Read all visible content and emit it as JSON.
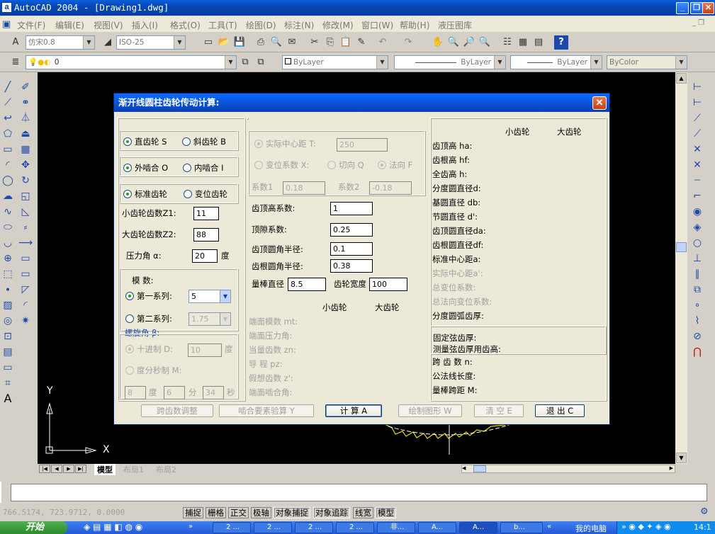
{
  "app": {
    "title": "AutoCAD 2004 - [Drawing1.dwg]"
  },
  "menu": [
    "文件(F)",
    "编辑(E)",
    "视图(V)",
    "插入(I)",
    "格式(O)",
    "工具(T)",
    "绘图(D)",
    "标注(N)",
    "修改(M)",
    "窗口(W)",
    "帮助(H)",
    "液压图库"
  ],
  "toolbar": {
    "text_style": "仿宋0.8",
    "dim_style": "ISO-25",
    "layer": "0",
    "color": "ByLayer",
    "linetype": "ByLayer",
    "lineweight": "ByLayer",
    "plotstyle": "ByColor"
  },
  "dialog": {
    "title": "渐开线圆柱齿轮传动计算:",
    "left": {
      "spur": "直齿轮 S",
      "helical": "斜齿轮 B",
      "external": "外啮合 O",
      "internal": "内啮合 I",
      "standard": "标准齿轮",
      "shifted": "变位齿轮",
      "z1_label": "小齿轮齿数Z1:",
      "z1": "11",
      "z2_label": "大齿轮齿数Z2:",
      "z2": "88",
      "alpha_label": "压力角 α:",
      "alpha": "20",
      "alpha_unit": "度",
      "module_label": "模  数:",
      "series1": "第一系列:",
      "series1_val": "5",
      "series2": "第二系列:",
      "series2_val": "1.75",
      "helix_label": "螺旋角 β:",
      "decimal": "十进制 D:",
      "decimal_val": "10",
      "decimal_unit": "度",
      "dms": "度分秒制 M:",
      "deg_val": "8",
      "deg_unit": "度",
      "min_val": "6",
      "min_unit": "分",
      "sec_val": "34",
      "sec_unit": "秒"
    },
    "middle": {
      "actual_center": "实际中心距 T:",
      "actual_center_val": "250",
      "shift_coef": "变位系数 X:",
      "tangential": "切向 Q",
      "normal": "法向 F",
      "coef1": "系数1",
      "coef1_val": "0.18",
      "coef2": "系数2",
      "coef2_val": "-0.18",
      "addendum_coef": "齿顶高系数:",
      "addendum_coef_val": "1",
      "clearance_coef": "顶隙系数:",
      "clearance_coef_val": "0.25",
      "tip_radius": "齿顶圆角半径:",
      "tip_radius_val": "0.1",
      "root_radius": "齿根圆角半径:",
      "root_radius_val": "0.38",
      "rod_dia": "量棒直径",
      "rod_dia_val": "8.5",
      "face_width": "齿轮宽度",
      "face_width_val": "100",
      "small_gear": "小齿轮",
      "large_gear": "大齿轮",
      "rows": [
        "端面模数 mt:",
        "端面压力角:",
        "当量齿数 zn:",
        "导  程 pz:",
        "假想齿数 z':",
        "端面啮合角:"
      ]
    },
    "right": {
      "small_gear": "小齿轮",
      "large_gear": "大齿轮",
      "rows": [
        "齿顶高 ha:",
        "齿根高 hf:",
        "全齿高 h:",
        "分度圆直径d:",
        "基圆直径 db:",
        "节圆直径 d':",
        "齿顶圆直径da:",
        "齿根圆直径df:",
        "标准中心距a:",
        "实际中心距a':",
        "总变位系数:",
        "总法向变位系数:",
        "分度圆弧齿厚:"
      ],
      "fixed_chord": "固定弦齿厚:",
      "chord_height": "测量弦齿厚用齿高:",
      "span_teeth": "跨 齿 数 n:",
      "common_normal": "公法线长度:",
      "rod_span": "量棒跨距 M:"
    },
    "buttons": [
      "跨齿数调整",
      "啮合要素验算 Y",
      "计 算 A",
      "绘制图形 W",
      "清 空 E",
      "退 出 C"
    ]
  },
  "tabs": [
    "模型",
    "布局1",
    "布局2"
  ],
  "status": {
    "coords": "766.5174, 723.9712, 0.0000",
    "buttons": [
      "捕捉",
      "栅格",
      "正交",
      "极轴",
      "对象捕捉",
      "对象追踪",
      "线宽",
      "模型"
    ]
  },
  "taskbar": {
    "start": "开始",
    "tasks": [
      "2 ...",
      "2 ...",
      "2 ...",
      "2 ...",
      "非...",
      "A...",
      "A...",
      "b..."
    ],
    "my_pc": "我的电脑",
    "clock": "14:1"
  },
  "axis": {
    "x": "X",
    "y": "Y"
  }
}
